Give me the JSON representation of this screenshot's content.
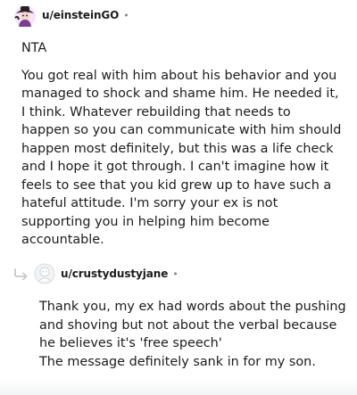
{
  "comment1": {
    "username": "u/einsteinGO",
    "separator": "•",
    "paragraphs": [
      "NTA",
      "You got real with him about his behavior and you managed to shock and shame him. He needed it, I think. Whatever rebuilding that needs to happen so you can communicate with him should happen most definitely, but this was a life check and I hope it got through. I can't imagine how it feels to see that you kid grew up to have such a hateful attitude. I'm sorry your ex is not supporting you in helping him become accountable."
    ]
  },
  "comment2": {
    "username": "u/crustydustyjane",
    "separator": "•",
    "lines": [
      "Thank you, my ex had words about the pushing and shoving but not about the verbal because he believes it's 'free speech'",
      "The message definitely sank in for my son."
    ]
  },
  "colors": {
    "text": "#1c1c1c",
    "muted": "#878a8c",
    "reply_arrow": "#c6c9cc"
  }
}
